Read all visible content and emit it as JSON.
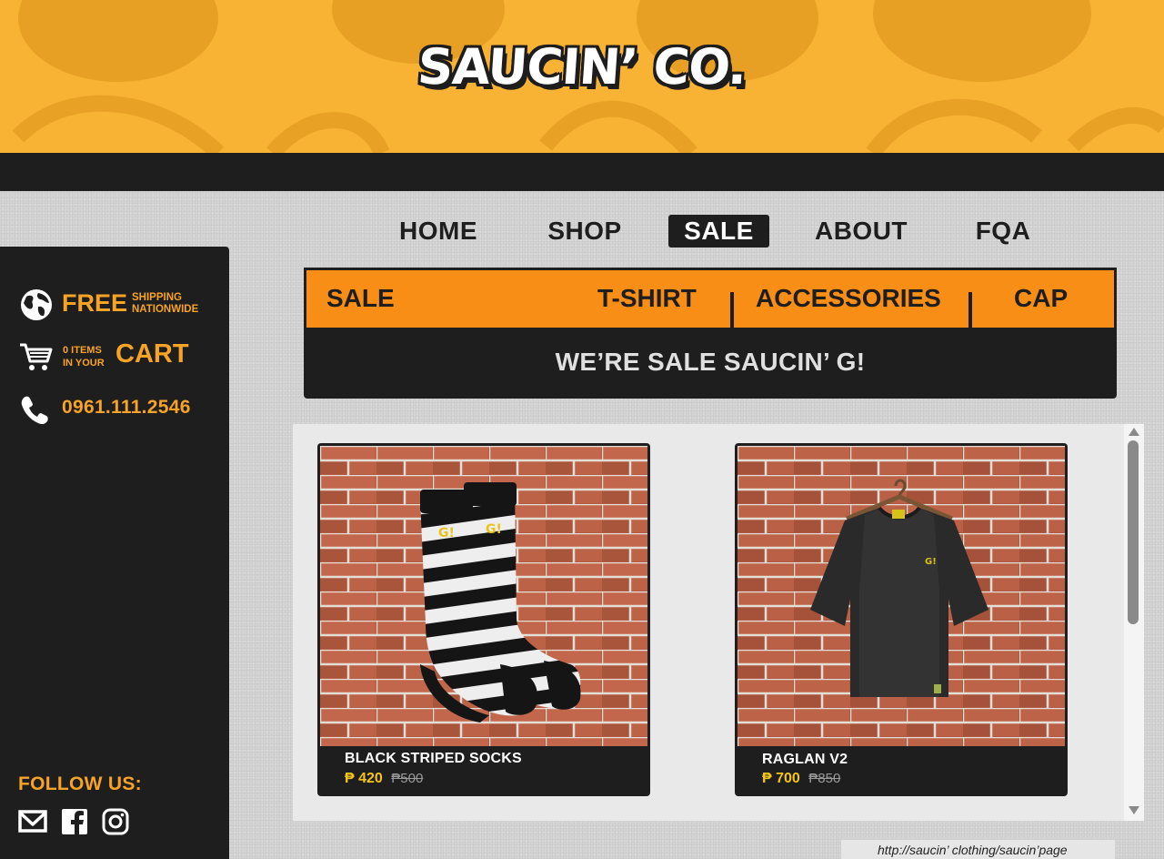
{
  "brand": {
    "logo_text": "SAUCIN’ CO."
  },
  "nav": {
    "items": [
      {
        "label": "HOME"
      },
      {
        "label": "SHOP"
      },
      {
        "label": "SALE",
        "active": true
      },
      {
        "label": "ABOUT"
      },
      {
        "label": "FQA"
      }
    ]
  },
  "sidebar": {
    "shipping": {
      "big": "FREE",
      "small_line1": "SHIPPING",
      "small_line2": "NATIONWIDE",
      "icon": "globe-icon"
    },
    "cart": {
      "items_line1": "0 ITEMS",
      "items_line2": "IN YOUR",
      "big": "CART",
      "icon": "cart-icon"
    },
    "phone": {
      "number": "0961.111.2546",
      "icon": "phone-icon"
    },
    "follow_label": "FOLLOW US:",
    "social": [
      "mail-icon",
      "facebook-icon",
      "instagram-icon"
    ]
  },
  "categories": {
    "title": "SALE",
    "items": [
      "T-SHIRT",
      "ACCESSORIES",
      "CAP"
    ]
  },
  "banner_text": "WE’RE SALE SAUCIN’ G!",
  "products": [
    {
      "name": "BLACK STRIPED SOCKS",
      "price": "₱ 420",
      "old_price": "₱500"
    },
    {
      "name": "RAGLAN V2",
      "price": "₱ 700",
      "old_price": "₱850"
    }
  ],
  "status_url": "http://saucin’ clothing/saucin’page",
  "colors": {
    "banner_yellow": "#f8b234",
    "accent_orange": "#f98e16",
    "sidebar_text": "#f7a325",
    "dark": "#1e1e1e",
    "price_yellow": "#f5c518"
  }
}
